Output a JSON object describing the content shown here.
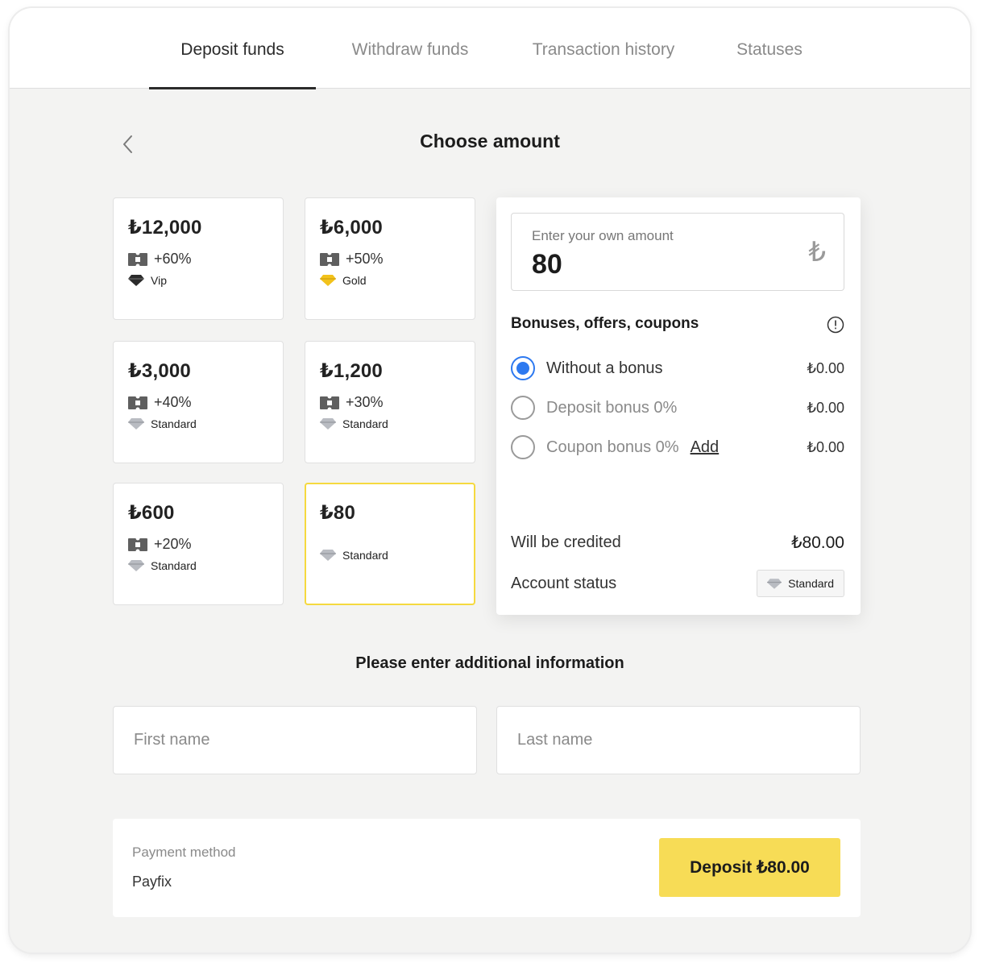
{
  "tabs": [
    {
      "label": "Deposit funds",
      "active": true
    },
    {
      "label": "Withdraw funds",
      "active": false
    },
    {
      "label": "Transaction history",
      "active": false
    },
    {
      "label": "Statuses",
      "active": false
    }
  ],
  "header": {
    "title": "Choose amount"
  },
  "amounts": [
    {
      "amount": "₺12,000",
      "bonus": "+60%",
      "status": "Vip",
      "selected": false
    },
    {
      "amount": "₺6,000",
      "bonus": "+50%",
      "status": "Gold",
      "selected": false
    },
    {
      "amount": "₺3,000",
      "bonus": "+40%",
      "status": "Standard",
      "selected": false
    },
    {
      "amount": "₺1,200",
      "bonus": "+30%",
      "status": "Standard",
      "selected": false
    },
    {
      "amount": "₺600",
      "bonus": "+20%",
      "status": "Standard",
      "selected": false
    },
    {
      "amount": "₺80",
      "bonus": "",
      "status": "Standard",
      "selected": true
    }
  ],
  "own_amount": {
    "label": "Enter your own amount",
    "value": "80",
    "currency": "₺"
  },
  "bonuses": {
    "title": "Bonuses, offers, coupons",
    "options": [
      {
        "label": "Without a bonus",
        "value": "₺0.00",
        "selected": true
      },
      {
        "label": "Deposit bonus 0%",
        "value": "₺0.00",
        "selected": false
      },
      {
        "label": "Coupon bonus 0%",
        "value": "₺0.00",
        "selected": false,
        "action": "Add"
      }
    ]
  },
  "summary": {
    "credited_label": "Will be credited",
    "credited_value": "₺80.00",
    "status_label": "Account status",
    "status_value": "Standard"
  },
  "additional": {
    "title": "Please enter additional information",
    "first_name_placeholder": "First name",
    "last_name_placeholder": "Last name",
    "first_name_value": "",
    "last_name_value": ""
  },
  "payment": {
    "label": "Payment method",
    "method": "Payfix",
    "button": "Deposit ₺80.00"
  },
  "colors": {
    "accent": "#f7dc56",
    "radio": "#2d79f0",
    "selected_border": "#f5d93f",
    "gold": "#f2c21b"
  }
}
